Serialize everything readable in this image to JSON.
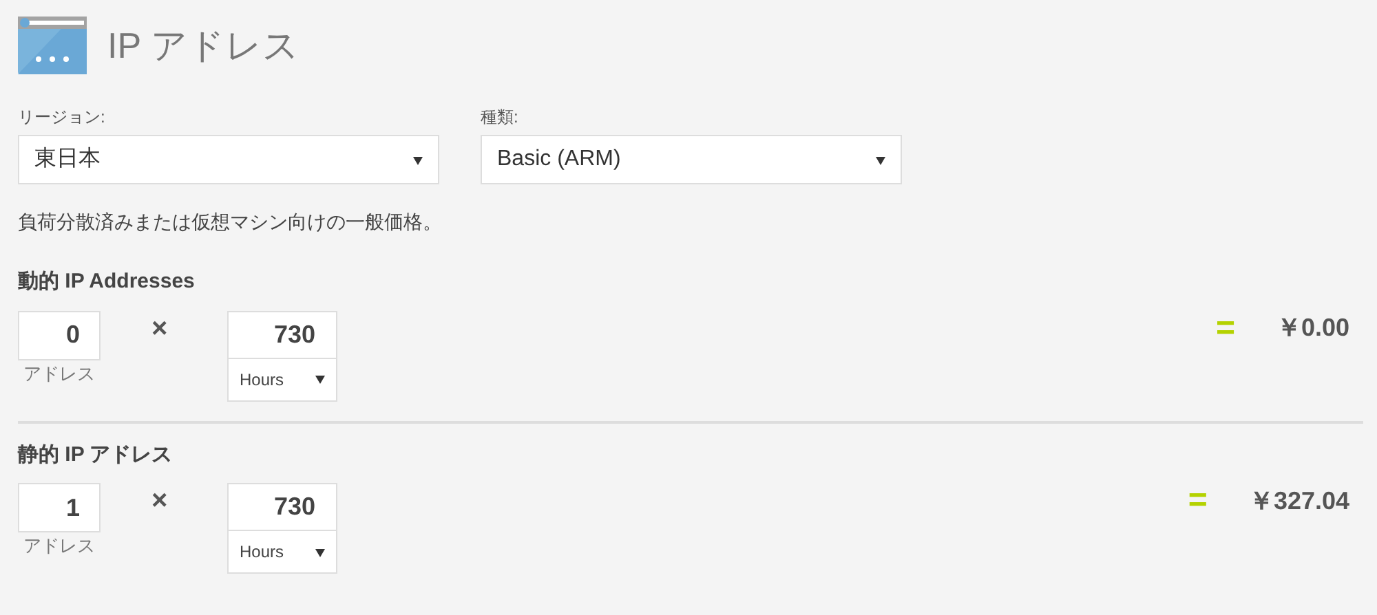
{
  "title": "IP アドレス",
  "filters": [
    {
      "label": "リージョン:",
      "value": "東日本"
    },
    {
      "label": "種類:",
      "value": "Basic (ARM)"
    }
  ],
  "description": "負荷分散済みまたは仮想マシン向けの一般価格。",
  "sections": [
    {
      "title": "動的 IP Addresses",
      "quantity": "0",
      "unit": "アドレス",
      "times": "×",
      "hours": "730",
      "hours_unit": "Hours",
      "equals": "=",
      "price": "￥0.00"
    },
    {
      "title": "静的 IP アドレス",
      "quantity": "1",
      "unit": "アドレス",
      "times": "×",
      "hours": "730",
      "hours_unit": "Hours",
      "equals": "=",
      "price": "￥327.04"
    }
  ]
}
